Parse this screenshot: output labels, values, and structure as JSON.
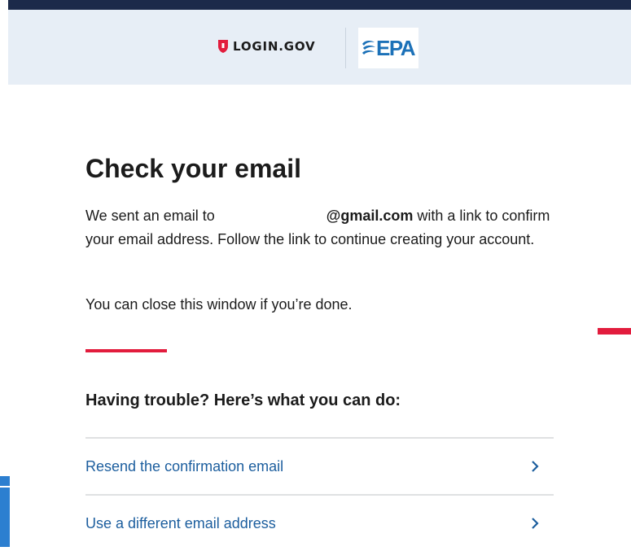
{
  "header": {
    "login_logo_text": "LOGIN.GOV",
    "login_logo_icon": "shield-icon",
    "partner_logo_text": "EPA",
    "partner_logo_icon": "epa-flower-icon"
  },
  "main": {
    "title": "Check your email",
    "intro_prefix": "We sent an email to",
    "intro_email_domain": "@gmail.com",
    "intro_suffix": "with a link to confirm your email address. Follow the link to continue creating your account.",
    "close_note": "You can close this window if you’re done."
  },
  "trouble": {
    "heading": "Having trouble? Here’s what you can do:",
    "options": [
      {
        "label": "Resend the confirmation email",
        "icon": "chevron-right-icon"
      },
      {
        "label": "Use a different email address",
        "icon": "chevron-right-icon"
      }
    ]
  },
  "colors": {
    "accent_red": "#e21c3d",
    "link_blue": "#1c5e9e",
    "header_bg": "#e7eef6",
    "top_bar": "#1c2a4a",
    "epa_blue": "#1c71b8"
  }
}
